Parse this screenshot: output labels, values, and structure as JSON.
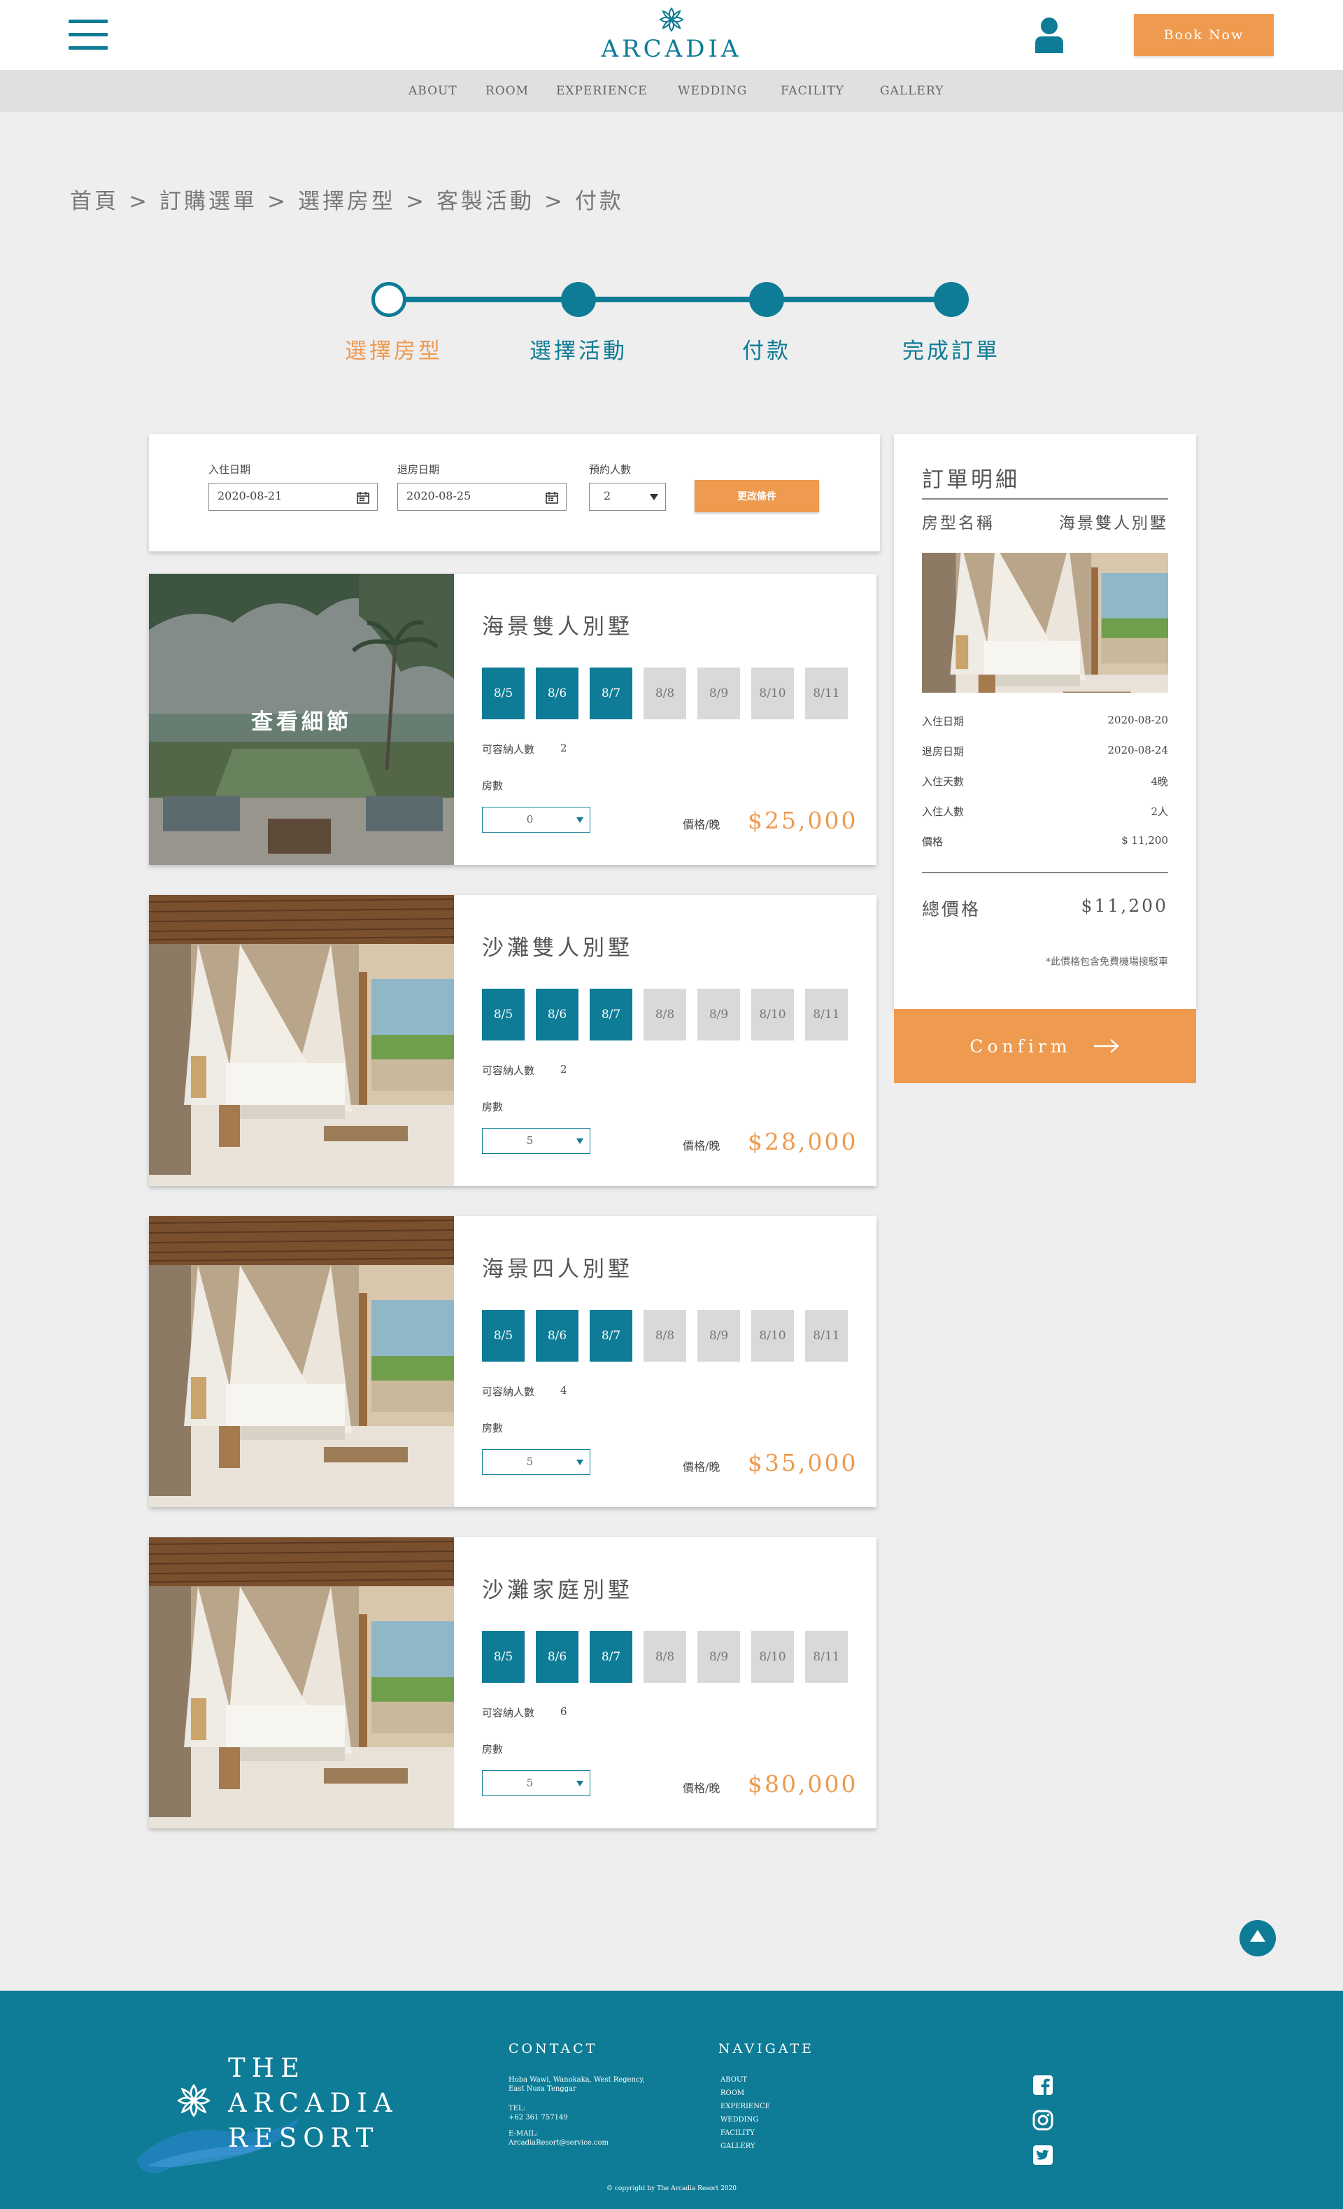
{
  "header": {
    "logo_text": "ARCADIA",
    "book_now": "Book Now",
    "nav": [
      "ABOUT",
      "ROOM",
      "EXPERIENCE",
      "WEDDING",
      "FACILITY",
      "GALLERY"
    ]
  },
  "breadcrumb": [
    "首頁",
    "訂購選單",
    "選擇房型",
    "客製活動",
    "付款"
  ],
  "breadcrumb_separator": ">",
  "stepper": {
    "steps": [
      "選擇房型",
      "選擇活動",
      "付款",
      "完成訂單"
    ],
    "current_index": 0
  },
  "search": {
    "checkin_label": "入住日期",
    "checkin_value": "2020-08-21",
    "checkout_label": "退房日期",
    "checkout_value": "2020-08-25",
    "guests_label": "預約人數",
    "guests_value": "2",
    "update_button": "更改條件"
  },
  "rooms": [
    {
      "name": "海景雙人別墅",
      "dates": [
        "8/5",
        "8/6",
        "8/7",
        "8/8",
        "8/9",
        "8/10",
        "8/11"
      ],
      "available_count": 3,
      "capacity_label": "可容納人數",
      "capacity": "2",
      "rooms_label": "房數",
      "rooms_value": "0",
      "price_label": "價格/晚",
      "price": "$25,000",
      "overlay": "查看細節"
    },
    {
      "name": "沙灘雙人別墅",
      "dates": [
        "8/5",
        "8/6",
        "8/7",
        "8/8",
        "8/9",
        "8/10",
        "8/11"
      ],
      "available_count": 3,
      "capacity_label": "可容納人數",
      "capacity": "2",
      "rooms_label": "房數",
      "rooms_value": "5",
      "price_label": "價格/晚",
      "price": "$28,000"
    },
    {
      "name": "海景四人別墅",
      "dates": [
        "8/5",
        "8/6",
        "8/7",
        "8/8",
        "8/9",
        "8/10",
        "8/11"
      ],
      "available_count": 3,
      "capacity_label": "可容納人數",
      "capacity": "4",
      "rooms_label": "房數",
      "rooms_value": "5",
      "price_label": "價格/晚",
      "price": "$35,000"
    },
    {
      "name": "沙灘家庭別墅",
      "dates": [
        "8/5",
        "8/6",
        "8/7",
        "8/8",
        "8/9",
        "8/10",
        "8/11"
      ],
      "available_count": 3,
      "capacity_label": "可容納人數",
      "capacity": "6",
      "rooms_label": "房數",
      "rooms_value": "5",
      "price_label": "價格/晚",
      "price": "$80,000"
    }
  ],
  "summary": {
    "title": "訂單明細",
    "room_type_label": "房型名稱",
    "room_type_value": "海景雙人別墅",
    "rows": [
      {
        "label": "入住日期",
        "value": "2020-08-20"
      },
      {
        "label": "退房日期",
        "value": "2020-08-24"
      },
      {
        "label": "入住天數",
        "value": "4晚"
      },
      {
        "label": "入住人數",
        "value": "2人"
      },
      {
        "label": "價格",
        "value": "$ 11,200"
      }
    ],
    "total_label": "總價格",
    "total_value": "$11,200",
    "note": "*此價格包含免費機場接駁車",
    "confirm": "Confirm"
  },
  "footer": {
    "brand_line1": "THE",
    "brand_line2": "ARCADIA",
    "brand_line3": "RESORT",
    "contact_heading": "CONTACT",
    "address": "Hoba Wawi, Wanokaka, West Regency, East Nusa Tenggar",
    "tel_label": "TEL:",
    "tel": "+62 361 757149",
    "email_label": "E-MAIL:",
    "email": "ArcadiaResort@service.com",
    "navigate_heading": "NAVIGATE",
    "nav": [
      "ABOUT",
      "ROOM",
      "EXPERIENCE",
      "WEDDING",
      "FACILITY",
      "GALLERY"
    ],
    "copyright": "© copyright by The Arcadia Resort 2020"
  },
  "icons": {
    "menu": "hamburger-icon",
    "user": "user-icon",
    "calendar": "calendar-icon",
    "arrow": "arrow-right-icon",
    "top": "arrow-up-icon",
    "facebook": "facebook-icon",
    "instagram": "instagram-icon",
    "twitter": "twitter-icon"
  },
  "colors": {
    "teal": "#0e7c96",
    "orange": "#ee9a4f",
    "background": "#eeeeee",
    "chip_off": "#d9d9d9"
  }
}
